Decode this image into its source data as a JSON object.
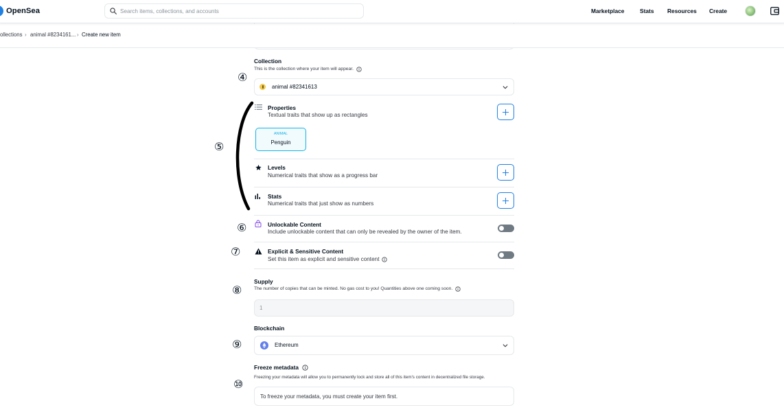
{
  "header": {
    "logo_text": "OpenSea",
    "search": {
      "placeholder": "Search items, collections, and accounts"
    },
    "nav": [
      "Marketplace",
      "Stats",
      "Resources",
      "Create"
    ]
  },
  "breadcrumb": {
    "separator": "›",
    "items": [
      "ollections",
      "animal #8234161...",
      "Create new item"
    ]
  },
  "annotations": [
    "④",
    "⑤",
    "⑥",
    "⑦",
    "⑧",
    "⑨",
    "⑩"
  ],
  "form": {
    "collection": {
      "label": "Collection",
      "description": "This is the collection where your item will appear.",
      "selected": "animal #82341613"
    },
    "properties": {
      "icon": "list-icon",
      "label": "Properties",
      "description": "Textual traits that show up as rectangles",
      "items": [
        {
          "type": "ANIMAL",
          "value": "Penguin"
        }
      ]
    },
    "levels": {
      "icon": "star-icon",
      "label": "Levels",
      "description": "Numerical traits that show as a progress bar"
    },
    "stats": {
      "icon": "bar-chart-icon",
      "label": "Stats",
      "description": "Numerical traits that just show as numbers"
    },
    "unlockable": {
      "icon": "lock-icon",
      "label": "Unlockable Content",
      "description": "Include unlockable content that can only be revealed by the owner of the item.",
      "enabled": false
    },
    "explicit": {
      "icon": "warning-icon",
      "label": "Explicit & Sensitive Content",
      "description": "Set this item as explicit and sensitive content",
      "enabled": false
    },
    "supply": {
      "label": "Supply",
      "description": "The number of copies that can be minted. No gas cost to you! Quantities above one coming soon.",
      "value": "1"
    },
    "blockchain": {
      "icon": "ethereum-icon",
      "label": "Blockchain",
      "selected": "Ethereum"
    },
    "freeze_metadata": {
      "label": "Freeze metadata",
      "description": "Freezing your metadata will allow you to permanently lock and store all of this item's content in decentralized file storage.",
      "message": "To freeze your metadata, you must create your item first."
    }
  },
  "colors": {
    "accent": "#2081e2",
    "text": "#04111d",
    "muted": "#707a83",
    "border": "#e5e8eb",
    "property_accent": "#15b2e5",
    "lock": "#8247e5",
    "ethereum": "#627eea"
  }
}
